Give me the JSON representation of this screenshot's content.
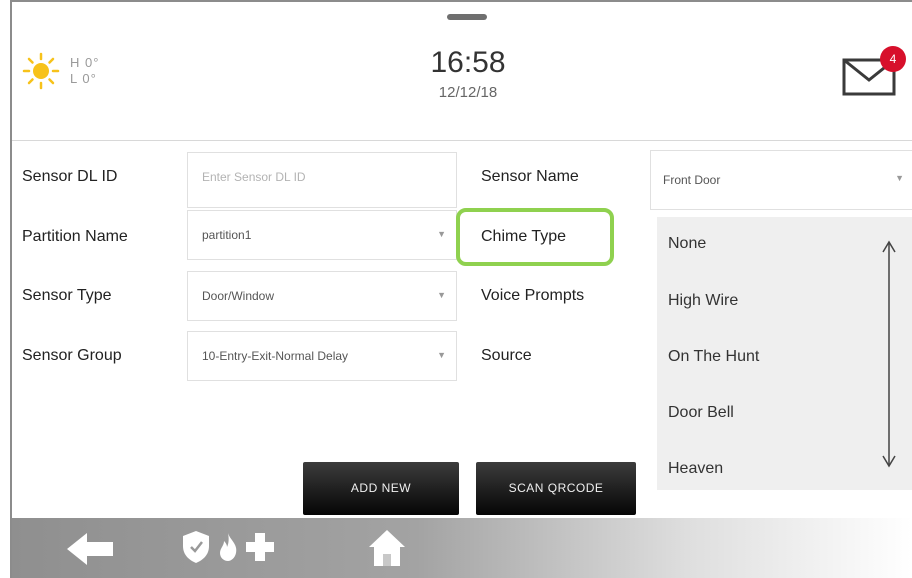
{
  "header": {
    "weather": {
      "high": "H 0°",
      "low": "L 0°",
      "icon": "sun-icon"
    },
    "time": "16:58",
    "date": "12/12/18",
    "mail_badge_count": "4",
    "colors": {
      "badge": "#d7102b",
      "sun": "#f7c21a"
    }
  },
  "form": {
    "sensor_dl_id": {
      "label": "Sensor DL ID",
      "placeholder": "Enter Sensor DL ID",
      "value": ""
    },
    "partition_name": {
      "label": "Partition Name",
      "value": "partition1"
    },
    "sensor_type": {
      "label": "Sensor Type",
      "value": "Door/Window"
    },
    "sensor_group": {
      "label": "Sensor Group",
      "value": "10-Entry-Exit-Normal Delay"
    },
    "sensor_name": {
      "label": "Sensor Name",
      "value": "Front Door"
    },
    "chime_type": {
      "label": "Chime Type"
    },
    "voice_prompts": {
      "label": "Voice Prompts"
    },
    "source": {
      "label": "Source"
    }
  },
  "chime_dropdown": {
    "options": [
      "None",
      "High Wire",
      "On The Hunt",
      "Door Bell",
      "Heaven"
    ]
  },
  "buttons": {
    "add_new": "ADD NEW",
    "scan_qrcode": "SCAN QRCODE"
  },
  "highlight_color": "#8fd14f",
  "bottom_bar": {
    "icons": [
      "back-arrow-icon",
      "shield-icon",
      "fire-icon",
      "medical-cross-icon",
      "home-icon"
    ]
  }
}
